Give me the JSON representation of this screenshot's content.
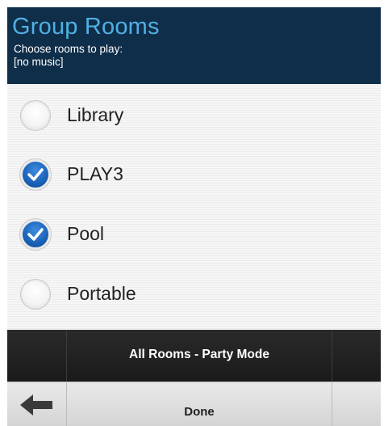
{
  "header": {
    "title": "Group Rooms",
    "subtitle": "Choose rooms to play:",
    "now_playing": "[no music]"
  },
  "rooms": [
    {
      "label": "Library",
      "checked": false
    },
    {
      "label": "PLAY3",
      "checked": true
    },
    {
      "label": "Pool",
      "checked": true
    },
    {
      "label": "Portable",
      "checked": false
    }
  ],
  "party_mode": {
    "label": "All Rooms - Party Mode"
  },
  "bottom_bar": {
    "back_icon": "arrow-left-icon",
    "done_label": "Done"
  },
  "colors": {
    "header_bg": "#0f2e4a",
    "title": "#4fb0e3",
    "check_blue": "#1a61b8"
  }
}
